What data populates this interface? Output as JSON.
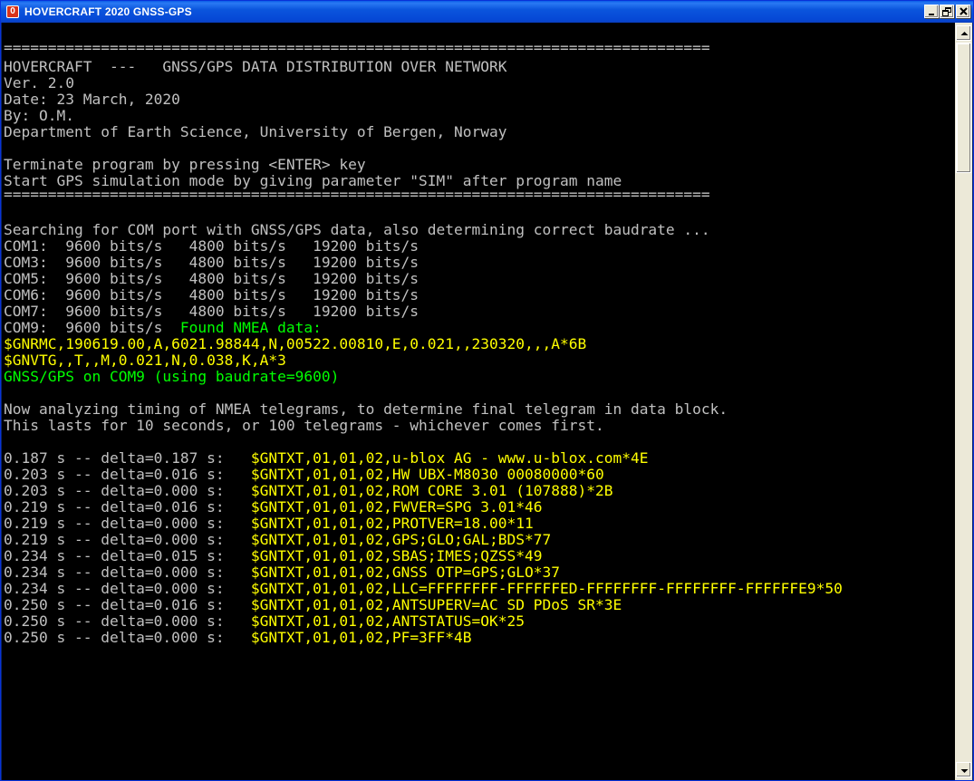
{
  "window": {
    "title": "HOVERCRAFT 2020 GNSS-GPS",
    "icon": "console-app-icon",
    "icon_glyph": "0",
    "controls": [
      "minimize-icon",
      "restore-icon",
      "close-icon"
    ]
  },
  "colors": {
    "title_bar": "#0a5ce8",
    "console_bg": "#000000",
    "console_text": "#c0c0c0",
    "highlight_yellow": "#ffff00",
    "highlight_green": "#00ff00"
  },
  "console": {
    "header": {
      "rule_top": "================================================================================",
      "title": "HOVERCRAFT  ---   GNSS/GPS DATA DISTRIBUTION OVER NETWORK",
      "version": "Ver. 2.0",
      "date": "Date: 23 March, 2020",
      "author": "By: O.M.",
      "institution": "Department of Earth Science, University of Bergen, Norway",
      "terminate_hint": "Terminate program by pressing <ENTER> key",
      "sim_hint": "Start GPS simulation mode by giving parameter \"SIM\" after program name",
      "rule_bottom": "================================================================================"
    },
    "search": {
      "intro": "Searching for COM port with GNSS/GPS data, also determining correct baudrate ...",
      "ports": [
        "COM1:  9600 bits/s   4800 bits/s   19200 bits/s",
        "COM3:  9600 bits/s   4800 bits/s   19200 bits/s",
        "COM5:  9600 bits/s   4800 bits/s   19200 bits/s",
        "COM6:  9600 bits/s   4800 bits/s   19200 bits/s",
        "COM7:  9600 bits/s   4800 bits/s   19200 bits/s"
      ],
      "found_prefix": "COM9:  9600 bits/s  ",
      "found_label": "Found NMEA data:",
      "nmea_lines": [
        "$GNRMC,190619.00,A,6021.98844,N,00522.00810,E,0.021,,230320,,,A*6B",
        "$GNVTG,,T,,M,0.021,N,0.038,K,A*3"
      ],
      "result": "GNSS/GPS on COM9 (using baudrate=9600)"
    },
    "analysis": {
      "line1": "Now analyzing timing of NMEA telegrams, to determine final telegram in data block.",
      "line2": "This lasts for 10 seconds, or 100 telegrams - whichever comes first."
    },
    "timing": [
      {
        "prefix": "0.187 s -- delta=0.187 s:   ",
        "telegram": "$GNTXT,01,01,02,u-blox AG - www.u-blox.com*4E"
      },
      {
        "prefix": "0.203 s -- delta=0.016 s:   ",
        "telegram": "$GNTXT,01,01,02,HW UBX-M8030 00080000*60"
      },
      {
        "prefix": "0.203 s -- delta=0.000 s:   ",
        "telegram": "$GNTXT,01,01,02,ROM CORE 3.01 (107888)*2B"
      },
      {
        "prefix": "0.219 s -- delta=0.016 s:   ",
        "telegram": "$GNTXT,01,01,02,FWVER=SPG 3.01*46"
      },
      {
        "prefix": "0.219 s -- delta=0.000 s:   ",
        "telegram": "$GNTXT,01,01,02,PROTVER=18.00*11"
      },
      {
        "prefix": "0.219 s -- delta=0.000 s:   ",
        "telegram": "$GNTXT,01,01,02,GPS;GLO;GAL;BDS*77"
      },
      {
        "prefix": "0.234 s -- delta=0.015 s:   ",
        "telegram": "$GNTXT,01,01,02,SBAS;IMES;QZSS*49"
      },
      {
        "prefix": "0.234 s -- delta=0.000 s:   ",
        "telegram": "$GNTXT,01,01,02,GNSS OTP=GPS;GLO*37"
      },
      {
        "prefix": "0.234 s -- delta=0.000 s:   ",
        "telegram": "$GNTXT,01,01,02,LLC=FFFFFFFF-FFFFFFED-FFFFFFFF-FFFFFFFF-FFFFFFE9*50"
      },
      {
        "prefix": "0.250 s -- delta=0.016 s:   ",
        "telegram": "$GNTXT,01,01,02,ANTSUPERV=AC SD PDoS SR*3E"
      },
      {
        "prefix": "0.250 s -- delta=0.000 s:   ",
        "telegram": "$GNTXT,01,01,02,ANTSTATUS=OK*25"
      },
      {
        "prefix": "0.250 s -- delta=0.000 s:   ",
        "telegram": "$GNTXT,01,01,02,PF=3FF*4B"
      }
    ]
  },
  "scrollbar": {
    "up_icon": "scroll-up-arrow-icon",
    "down_icon": "scroll-down-arrow-icon"
  }
}
